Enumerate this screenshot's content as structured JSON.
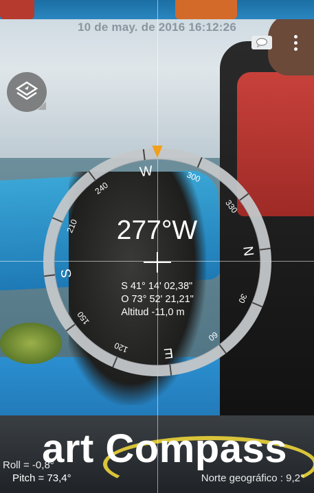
{
  "status": {
    "datetime": "10 de may. de 2016 16:12:26"
  },
  "toolbar": {
    "message_icon": "speech-bubble-icon",
    "menu_icon": "overflow-menu-icon"
  },
  "map_layers_icon": "layers-icon",
  "compass": {
    "heading": "277°W",
    "latitude": "S 41° 14' 02,38\"",
    "longitude": "O 73° 52' 21,21\"",
    "altitude": "Altitud -11,0 m",
    "cardinals": [
      "W",
      "N",
      "E",
      "S"
    ],
    "degree_labels": [
      "300",
      "330",
      "30",
      "60",
      "120",
      "150",
      "210",
      "240"
    ],
    "accent_color": "#f0a01e"
  },
  "sensors": {
    "roll": "Roll = -0,8°",
    "pitch": "Pitch = 73,4°",
    "north": "Norte geográfico : 9,2°"
  },
  "watermark": "art Compass"
}
